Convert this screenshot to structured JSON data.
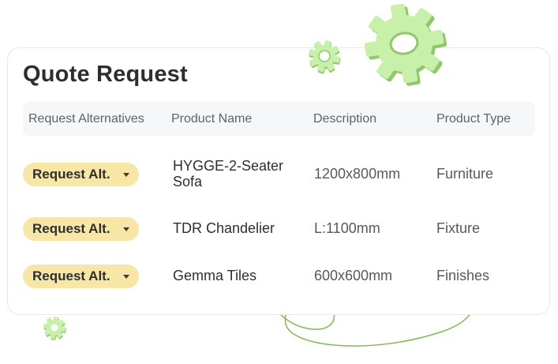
{
  "title": "Quote Request",
  "columns": [
    "Request Alternatives",
    "Product Name",
    "Description",
    "Product Type"
  ],
  "rows": [
    {
      "action_label": "Request Alt.",
      "product_name": "HYGGE-2-Seater Sofa",
      "description": "1200x800mm",
      "product_type": "Furniture"
    },
    {
      "action_label": "Request Alt.",
      "product_name": "TDR Chandelier",
      "description": "L:1100mm",
      "product_type": "Fixture"
    },
    {
      "action_label": "Request Alt.",
      "product_name": "Gemma Tiles",
      "description": "600x600mm",
      "product_type": "Finishes"
    }
  ],
  "icons": {
    "gear": "gear-icon",
    "dropdown": "chevron-down-icon",
    "swirl": "swirl-decoration"
  },
  "colors": {
    "pill_bg": "#f8e7a4",
    "gear_green": "#c7f0a8",
    "gear_shadow": "#8fc96a",
    "swirl_green": "#7cbc4a"
  }
}
